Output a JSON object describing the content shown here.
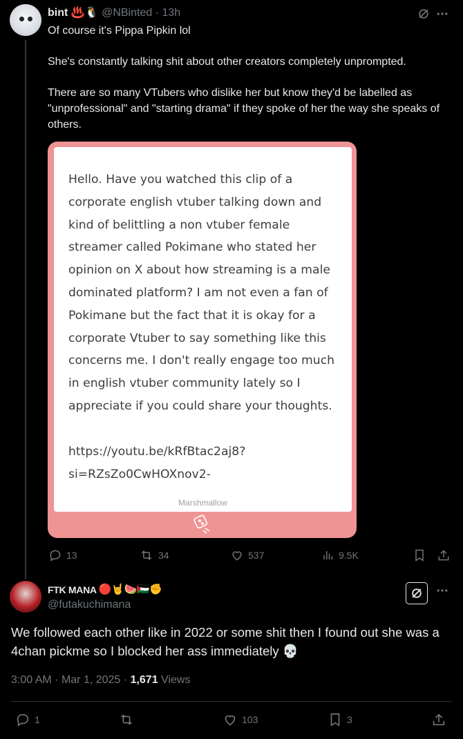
{
  "tweet1": {
    "display_name": "bint",
    "name_emojis": "♨️🐧",
    "handle": "@NBinted",
    "separator": "·",
    "time": "13h",
    "paragraphs": [
      "Of course it's Pippa Pipkin lol",
      "She's constantly talking shit about other creators completely unprompted.",
      "There are so many VTubers who dislike her but know they'd be labelled as \"unprofessional\" and \"starting drama\" if they spoke of her the way she speaks of others."
    ],
    "card": {
      "message": "Hello. Have you watched this clip of a corporate english vtuber talking down and kind of belittling a non vtuber female streamer called Pokimane who stated her opinion on X about how streaming is a male dominated platform? I am not even a fan of Pokimane but the fact that it is okay for a corporate Vtuber to say something like this concerns me. I don't really engage too much in english vtuber community lately so I appreciate if you could share your thoughts.",
      "link_line1": "https://youtu.be/kRfBtac2aj8?",
      "link_line2": "si=RZsZo0CwHOXnov2-",
      "brand": "Marshmallow",
      "colors": {
        "frame": "#ef9494",
        "inner": "#ffffff",
        "text": "#3d3d3d"
      }
    },
    "actions": {
      "replies": "13",
      "reposts": "34",
      "likes": "537",
      "views": "9.5K"
    }
  },
  "tweet2": {
    "display_name": "FTK MANA",
    "name_emojis": "🔴🤘🍉🇵🇸✊",
    "handle": "@futakuchimana",
    "text": "We followed each other like in 2022 or some shit then I found out she was a 4chan pickme so I blocked her ass immediately 💀",
    "time": "3:00 AM",
    "separator": "·",
    "date": "Mar 1, 2025",
    "views_count": "1,671",
    "views_label": "Views",
    "actions": {
      "replies": "1",
      "likes": "103",
      "bookmarks": "3"
    }
  },
  "icons": [
    "grok-icon",
    "more-icon",
    "reply-icon",
    "repost-icon",
    "like-icon",
    "views-icon",
    "bookmark-icon",
    "share-icon",
    "marshmallow-logo-icon"
  ],
  "colors": {
    "background": "#000000",
    "text": "#e7e9ea",
    "muted": "#71767b",
    "divider": "#2f3336"
  }
}
